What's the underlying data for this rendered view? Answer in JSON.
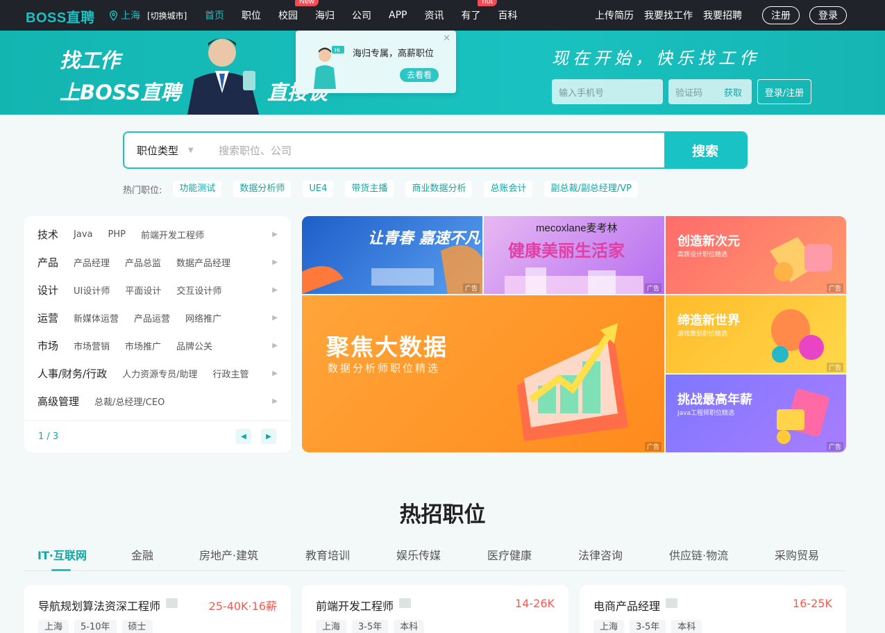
{
  "nav": {
    "logo": "BOSS直聘",
    "city": "上海",
    "switch_city": "[切换城市]",
    "links": [
      {
        "label": "首页",
        "badge": ""
      },
      {
        "label": "职位",
        "badge": ""
      },
      {
        "label": "校园",
        "badge": "New"
      },
      {
        "label": "海归",
        "badge": ""
      },
      {
        "label": "公司",
        "badge": ""
      },
      {
        "label": "APP",
        "badge": ""
      },
      {
        "label": "资讯",
        "badge": ""
      },
      {
        "label": "有了",
        "badge": "hot"
      },
      {
        "label": "百科",
        "badge": ""
      }
    ],
    "upload_resume": "上传简历",
    "find_job": "我要找工作",
    "recruit": "我要招聘",
    "register": "注册",
    "login": "登录"
  },
  "banner": {
    "slogan_line1": "找工作",
    "slogan_line2": "上BOSS直聘",
    "slogan_line3": "直接谈",
    "popup_text": "海归专属，高薪职位",
    "popup_button": "去看看",
    "motto": "现在开始，快乐找工作",
    "phone_placeholder": "输入手机号",
    "code_placeholder": "验证码",
    "get_code": "获取",
    "login_register": "登录/注册"
  },
  "search": {
    "category": "职位类型",
    "placeholder": "搜索职位、公司",
    "button": "搜索",
    "hot_label": "热门职位:",
    "hot_tags": [
      "功能测试",
      "数据分析师",
      "UE4",
      "带货主播",
      "商业数据分析",
      "总账会计",
      "副总裁/副总经理/VP"
    ]
  },
  "categories": {
    "rows": [
      {
        "name": "技术",
        "subs": [
          "Java",
          "PHP",
          "前端开发工程师"
        ]
      },
      {
        "name": "产品",
        "subs": [
          "产品经理",
          "产品总监",
          "数据产品经理"
        ]
      },
      {
        "name": "设计",
        "subs": [
          "UI设计师",
          "平面设计",
          "交互设计师"
        ]
      },
      {
        "name": "运营",
        "subs": [
          "新媒体运营",
          "产品运营",
          "网络推广"
        ]
      },
      {
        "name": "市场",
        "subs": [
          "市场营销",
          "市场推广",
          "品牌公关"
        ]
      },
      {
        "name": "人事/财务/行政",
        "subs": [
          "人力资源专员/助理",
          "行政主管"
        ]
      },
      {
        "name": "高级管理",
        "subs": [
          "总裁/总经理/CEO"
        ]
      }
    ],
    "pager": "1 / 3"
  },
  "ads": {
    "tag": "广告",
    "ad1": "让青春 嘉速不凡",
    "ad2_brand": "mecoxlane麦考林",
    "ad2": "健康美丽生活家",
    "ad3_title": "创造新次元",
    "ad3_sub": "高薪设计职位精选",
    "ad4_title": "聚焦大数据",
    "ad4_sub": "数据分析师职位精选",
    "ad5_title": "缔造新世界",
    "ad5_sub": "游戏策划职位精选",
    "ad6_title": "挑战最高年薪",
    "ad6_sub": "Java工程师职位精选"
  },
  "hot_jobs": {
    "title": "热招职位",
    "tabs": [
      "IT·互联网",
      "金融",
      "房地产·建筑",
      "教育培训",
      "娱乐传媒",
      "医疗健康",
      "法律咨询",
      "供应链·物流",
      "采购贸易"
    ],
    "jobs": [
      {
        "title": "导航规划算法资深工程师",
        "salary": "25-40K·16薪",
        "tags": [
          "上海",
          "5-10年",
          "硕士"
        ]
      },
      {
        "title": "前端开发工程师",
        "salary": "14-26K",
        "tags": [
          "上海",
          "3-5年",
          "本科"
        ]
      },
      {
        "title": "电商产品经理",
        "salary": "16-25K",
        "tags": [
          "上海",
          "3-5年",
          "本科"
        ]
      }
    ]
  }
}
